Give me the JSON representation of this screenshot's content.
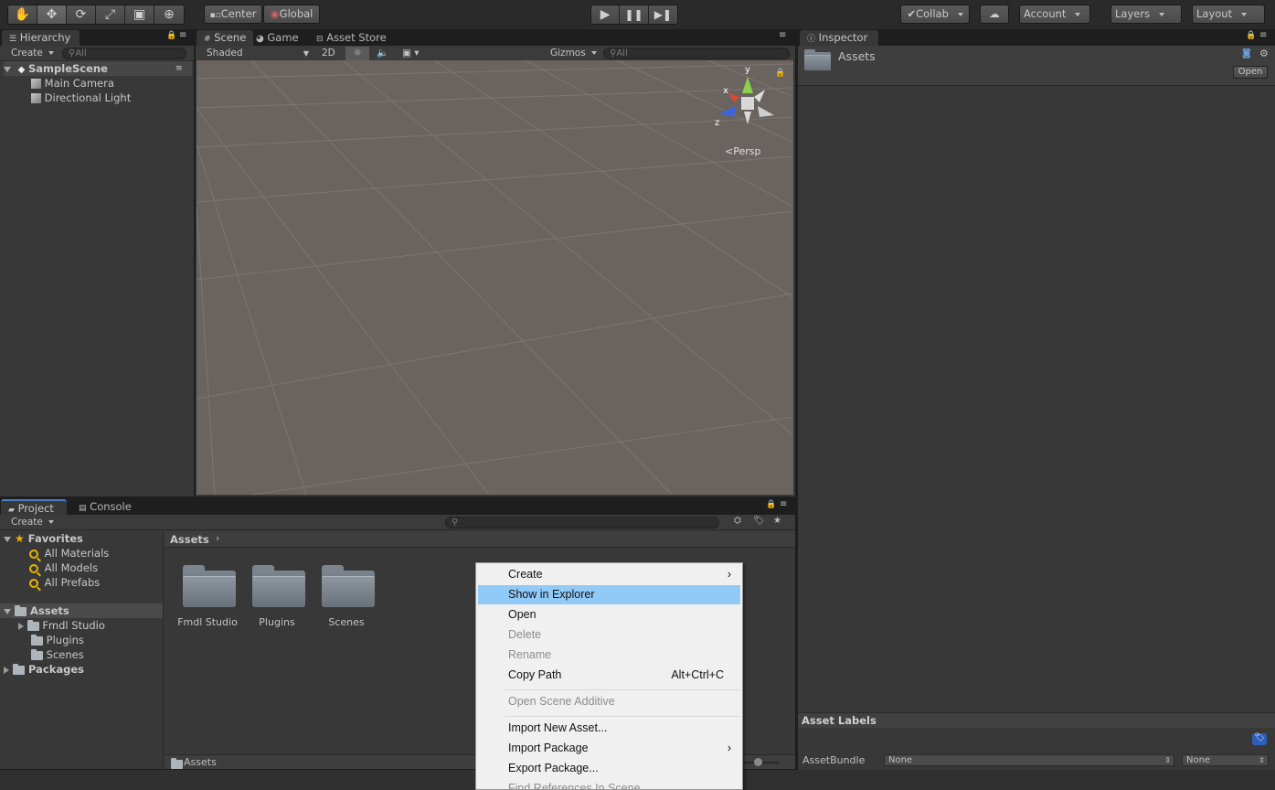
{
  "toolbar": {
    "pivot_center": "Center",
    "pivot_global": "Global",
    "collab": "Collab",
    "account": "Account",
    "layers": "Layers",
    "layout": "Layout"
  },
  "hierarchy": {
    "tab": "Hierarchy",
    "create": "Create",
    "search_placeholder": "All",
    "scene": "SampleScene",
    "items": [
      "Main Camera",
      "Directional Light"
    ]
  },
  "scene": {
    "tabs": [
      "Scene",
      "Game",
      "Asset Store"
    ],
    "shading": "Shaded",
    "mode_2d": "2D",
    "gizmos": "Gizmos",
    "search_placeholder": "All",
    "persp": "Persp",
    "axis_x": "x",
    "axis_y": "y",
    "axis_z": "z"
  },
  "inspector": {
    "tab": "Inspector",
    "title": "Assets",
    "open": "Open",
    "asset_labels": "Asset Labels",
    "asset_bundle": "AssetBundle",
    "bundle_value": "None",
    "variant_value": "None"
  },
  "project": {
    "tabs": [
      "Project",
      "Console"
    ],
    "create": "Create",
    "favorites": "Favorites",
    "favorite_items": [
      "All Materials",
      "All Models",
      "All Prefabs"
    ],
    "assets": "Assets",
    "asset_folders": [
      "Fmdl Studio",
      "Plugins",
      "Scenes"
    ],
    "packages": "Packages",
    "breadcrumb": "Assets",
    "footer_path": "Assets",
    "grid_folders": [
      "Fmdl Studio",
      "Plugins",
      "Scenes"
    ]
  },
  "context_menu": {
    "items": {
      "create": "Create",
      "show_in_explorer": "Show in Explorer",
      "open": "Open",
      "delete": "Delete",
      "rename": "Rename",
      "copy_path": "Copy Path",
      "copy_path_shortcut": "Alt+Ctrl+C",
      "open_scene_additive": "Open Scene Additive",
      "import_new_asset": "Import New Asset...",
      "import_package": "Import Package",
      "export_package": "Export Package...",
      "find_references": "Find References In Scene"
    }
  },
  "colors": {
    "highlight": "#91c9f7",
    "panel": "#383838",
    "scene_bg": "#6b6360"
  }
}
